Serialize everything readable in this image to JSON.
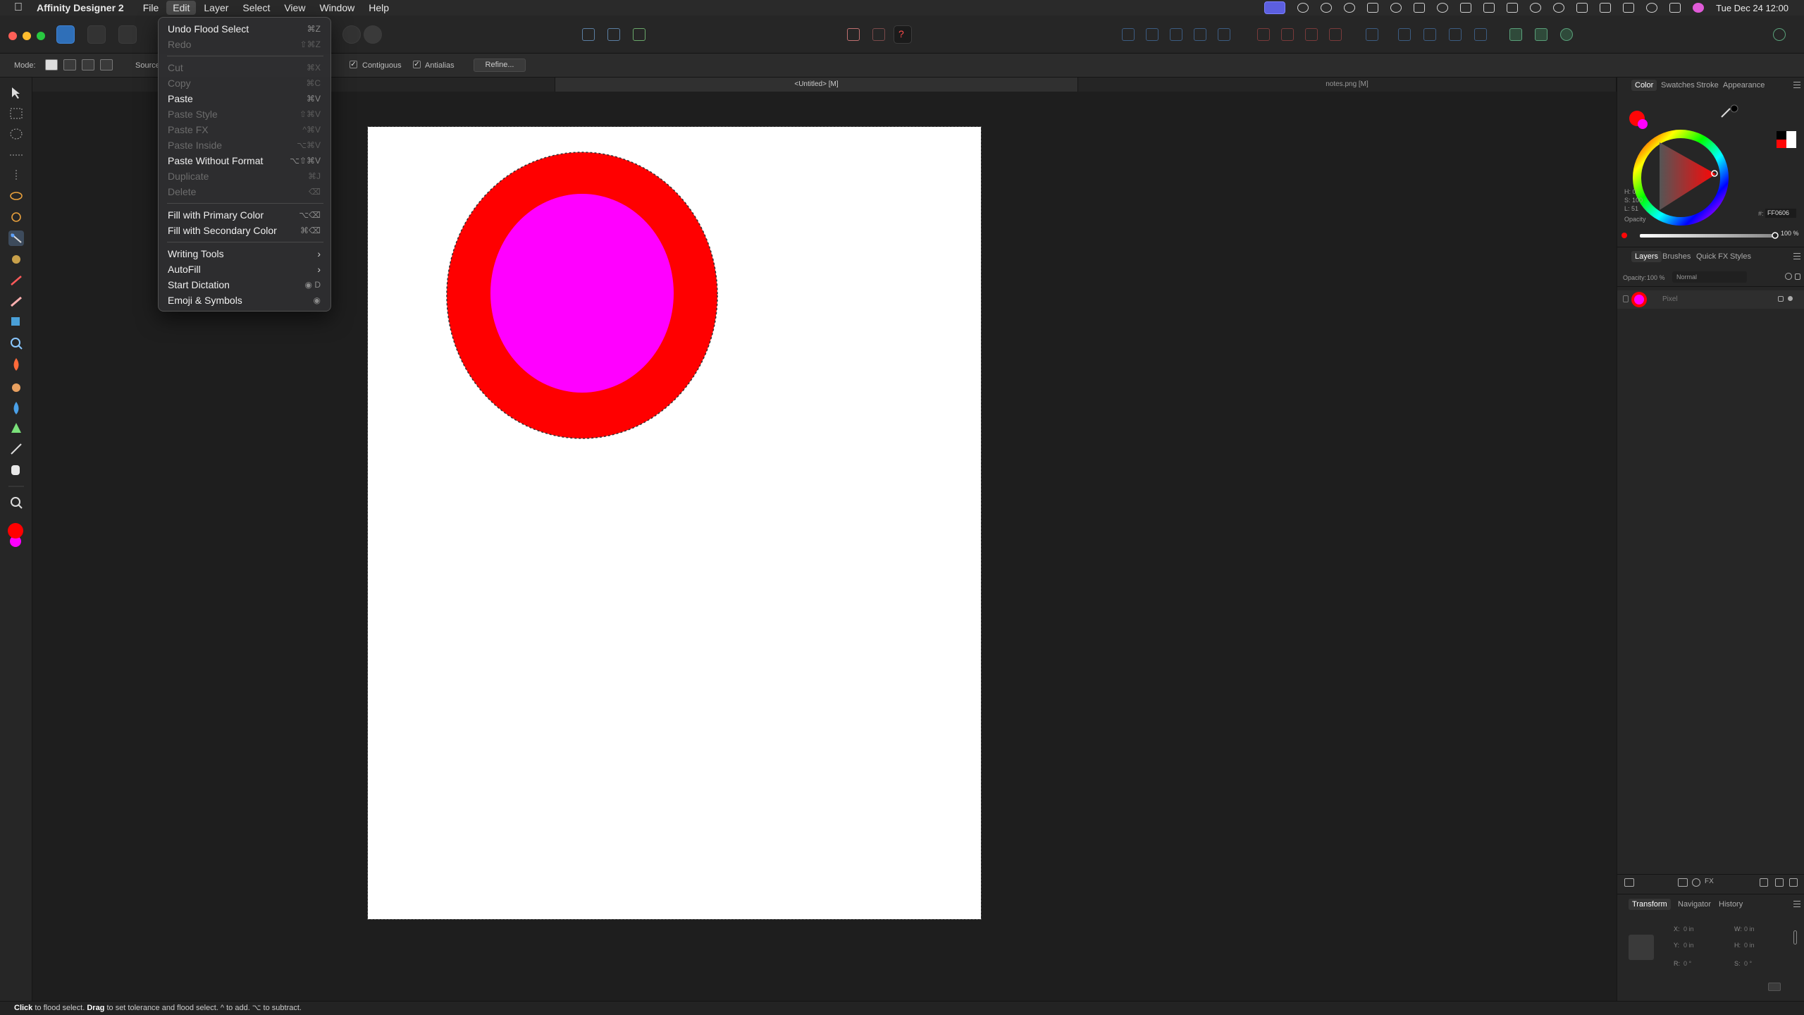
{
  "menubar": {
    "app_name": "Affinity Designer 2",
    "menus": [
      "File",
      "Edit",
      "Layer",
      "Select",
      "View",
      "Window",
      "Help"
    ],
    "active_menu": "Edit",
    "clock": "Tue Dec 24  12:00"
  },
  "context": {
    "mode_label": "Mode:",
    "source_label": "Source",
    "contiguous_label": "Contiguous",
    "antialias_label": "Antialias",
    "refine_label": "Refine..."
  },
  "tabs": [
    "<Untitled> [M]",
    "notes.png [M]"
  ],
  "edit_menu": {
    "items": [
      {
        "label": "Undo Flood Select",
        "shortcut": "⌘Z",
        "enabled": true
      },
      {
        "label": "Redo",
        "shortcut": "⇧⌘Z",
        "enabled": false
      },
      {
        "label": "Cut",
        "shortcut": "⌘X",
        "enabled": false
      },
      {
        "label": "Copy",
        "shortcut": "⌘C",
        "enabled": false
      },
      {
        "label": "Paste",
        "shortcut": "⌘V",
        "enabled": true
      },
      {
        "label": "Paste Style",
        "shortcut": "⇧⌘V",
        "enabled": false
      },
      {
        "label": "Paste FX",
        "shortcut": "^⌘V",
        "enabled": false
      },
      {
        "label": "Paste Inside",
        "shortcut": "⌥⌘V",
        "enabled": false
      },
      {
        "label": "Paste Without Format",
        "shortcut": "⌥⇧⌘V",
        "enabled": true
      },
      {
        "label": "Duplicate",
        "shortcut": "⌘J",
        "enabled": false
      },
      {
        "label": "Delete",
        "shortcut": "⌫",
        "enabled": false
      },
      {
        "label": "Fill with Primary Color",
        "shortcut": "⌥⌫",
        "enabled": true
      },
      {
        "label": "Fill with Secondary Color",
        "shortcut": "⌘⌫",
        "enabled": true
      },
      {
        "label": "Writing Tools",
        "shortcut": "",
        "enabled": true,
        "submenu": true
      },
      {
        "label": "AutoFill",
        "shortcut": "",
        "enabled": true,
        "submenu": true
      },
      {
        "label": "Start Dictation",
        "shortcut": "◉ D",
        "enabled": true
      },
      {
        "label": "Emoji & Symbols",
        "shortcut": "◉",
        "enabled": true
      }
    ]
  },
  "color_panel": {
    "tabs": [
      "Color",
      "Swatches",
      "Stroke",
      "Appearance"
    ],
    "active_tab": "Color",
    "h": "H: 0",
    "s": "S: 100",
    "l": "L: 51",
    "hex_label": "#:",
    "hex": "FF0606",
    "opacity_label": "Opacity",
    "opacity_value": "100 %",
    "primary_color": "#ff0606",
    "secondary_color": "#ff00ff"
  },
  "layers_panel": {
    "tabs": [
      "Layers",
      "Brushes",
      "Quick FX",
      "Styles"
    ],
    "active_tab": "Layers",
    "opacity_label": "Opacity:",
    "opacity_value": "100 %",
    "blend_mode": "Normal",
    "layer_name": "Pixel"
  },
  "transform_panel": {
    "tabs": [
      "Transform",
      "Navigator",
      "History"
    ],
    "active_tab": "Transform",
    "x": "X:",
    "x_val": "0 in",
    "y": "Y:",
    "y_val": "0 in",
    "w": "W:",
    "w_val": "0 in",
    "h": "H:",
    "h_val": "0 in",
    "r": "R:",
    "r_val": "0 °",
    "s": "S:",
    "s_val": "0 °"
  },
  "status": {
    "click": "Click",
    "click_text": " to flood select. ",
    "drag": "Drag",
    "drag_text": " to set tolerance and flood select. ^ to add. ⌥ to subtract."
  },
  "canvas_colors": {
    "outer_circle": "#ff0000",
    "inner_circle": "#ff00ff"
  }
}
